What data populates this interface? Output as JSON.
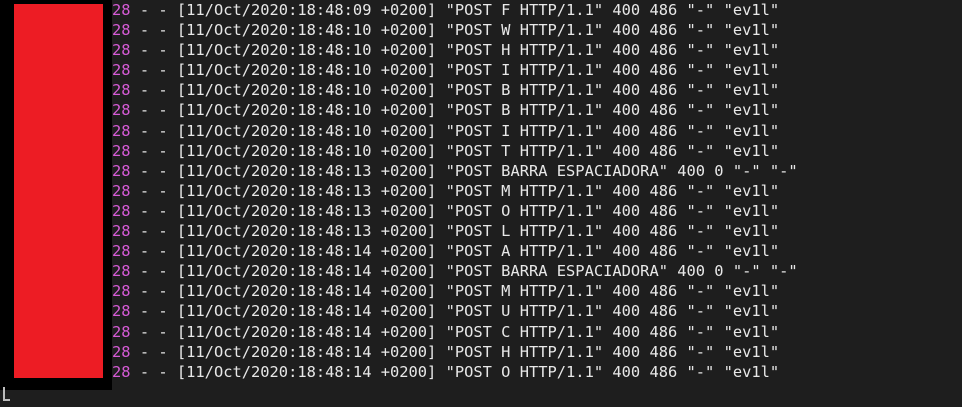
{
  "terminal": {
    "colors": {
      "background": "#1e1e1e",
      "text": "#e8e8e8",
      "ip_suffix": "#d65bd6",
      "redaction": "#ed1c24"
    },
    "log_lines": [
      {
        "ip_suffix": "28",
        "text": " - - [11/Oct/2020:18:48:09 +0200] \"POST F HTTP/1.1\" 400 486 \"-\" \"ev1l\""
      },
      {
        "ip_suffix": "28",
        "text": " - - [11/Oct/2020:18:48:10 +0200] \"POST W HTTP/1.1\" 400 486 \"-\" \"ev1l\""
      },
      {
        "ip_suffix": "28",
        "text": " - - [11/Oct/2020:18:48:10 +0200] \"POST H HTTP/1.1\" 400 486 \"-\" \"ev1l\""
      },
      {
        "ip_suffix": "28",
        "text": " - - [11/Oct/2020:18:48:10 +0200] \"POST I HTTP/1.1\" 400 486 \"-\" \"ev1l\""
      },
      {
        "ip_suffix": "28",
        "text": " - - [11/Oct/2020:18:48:10 +0200] \"POST B HTTP/1.1\" 400 486 \"-\" \"ev1l\""
      },
      {
        "ip_suffix": "28",
        "text": " - - [11/Oct/2020:18:48:10 +0200] \"POST B HTTP/1.1\" 400 486 \"-\" \"ev1l\""
      },
      {
        "ip_suffix": "28",
        "text": " - - [11/Oct/2020:18:48:10 +0200] \"POST I HTTP/1.1\" 400 486 \"-\" \"ev1l\""
      },
      {
        "ip_suffix": "28",
        "text": " - - [11/Oct/2020:18:48:10 +0200] \"POST T HTTP/1.1\" 400 486 \"-\" \"ev1l\""
      },
      {
        "ip_suffix": "28",
        "text": " - - [11/Oct/2020:18:48:13 +0200] \"POST BARRA ESPACIADORA\" 400 0 \"-\" \"-\""
      },
      {
        "ip_suffix": "28",
        "text": " - - [11/Oct/2020:18:48:13 +0200] \"POST M HTTP/1.1\" 400 486 \"-\" \"ev1l\""
      },
      {
        "ip_suffix": "28",
        "text": " - - [11/Oct/2020:18:48:13 +0200] \"POST O HTTP/1.1\" 400 486 \"-\" \"ev1l\""
      },
      {
        "ip_suffix": "28",
        "text": " - - [11/Oct/2020:18:48:13 +0200] \"POST L HTTP/1.1\" 400 486 \"-\" \"ev1l\""
      },
      {
        "ip_suffix": "28",
        "text": " - - [11/Oct/2020:18:48:14 +0200] \"POST A HTTP/1.1\" 400 486 \"-\" \"ev1l\""
      },
      {
        "ip_suffix": "28",
        "text": " - - [11/Oct/2020:18:48:14 +0200] \"POST BARRA ESPACIADORA\" 400 0 \"-\" \"-\""
      },
      {
        "ip_suffix": "28",
        "text": " - - [11/Oct/2020:18:48:14 +0200] \"POST M HTTP/1.1\" 400 486 \"-\" \"ev1l\""
      },
      {
        "ip_suffix": "28",
        "text": " - - [11/Oct/2020:18:48:14 +0200] \"POST U HTTP/1.1\" 400 486 \"-\" \"ev1l\""
      },
      {
        "ip_suffix": "28",
        "text": " - - [11/Oct/2020:18:48:14 +0200] \"POST C HTTP/1.1\" 400 486 \"-\" \"ev1l\""
      },
      {
        "ip_suffix": "28",
        "text": " - - [11/Oct/2020:18:48:14 +0200] \"POST H HTTP/1.1\" 400 486 \"-\" \"ev1l\""
      },
      {
        "ip_suffix": "28",
        "text": " - - [11/Oct/2020:18:48:14 +0200] \"POST O HTTP/1.1\" 400 486 \"-\" \"ev1l\""
      }
    ]
  }
}
